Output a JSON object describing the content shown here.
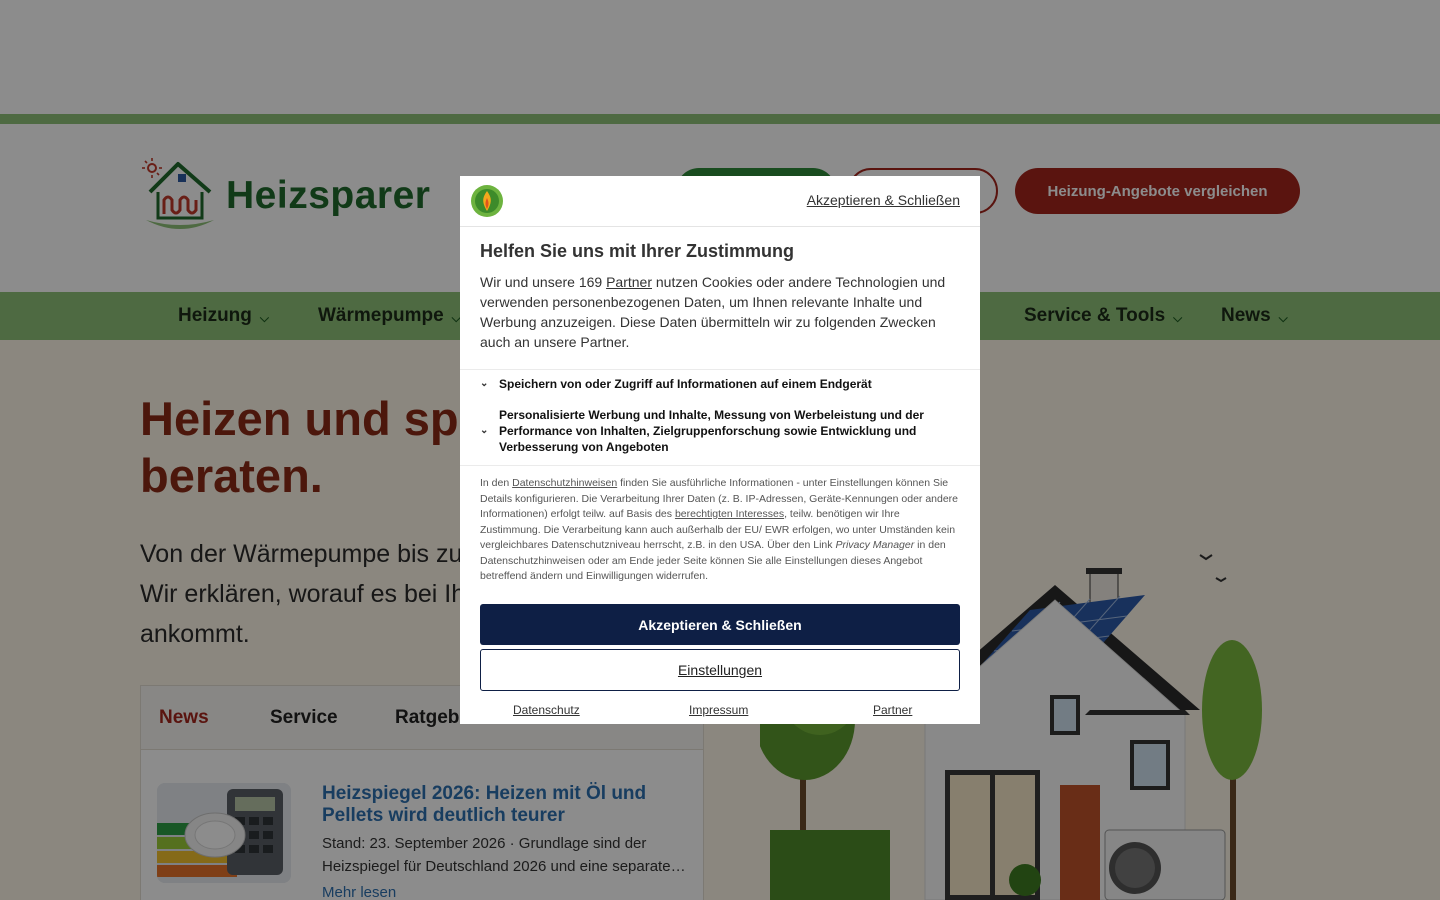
{
  "header": {
    "logo_text": "Heizsparer",
    "btn_partner_label": "",
    "btn_outline_label": "",
    "cta_label": "Heizung-Angebote vergleichen"
  },
  "nav": {
    "items": [
      {
        "label": "Heizung"
      },
      {
        "label": "Wärmepumpe"
      },
      {
        "label": "Service & Tools"
      },
      {
        "label": "News"
      }
    ]
  },
  "hero": {
    "title_line1": "Heizen und spar",
    "title_line2": "beraten.",
    "text_line1": "Von der Wärmepumpe bis zu",
    "text_line2": "Wir erklären, worauf es bei Ih",
    "text_line3": "ankommt."
  },
  "news": {
    "tabs": [
      {
        "label": "News",
        "active": true
      },
      {
        "label": "Service"
      },
      {
        "label": "Ratgebe"
      }
    ],
    "article": {
      "title": "Heizspiegel 2026: Heizen mit Öl und Pellets wird deutlich teurer",
      "text": "Stand: 23. September 2026 · Grundlage sind der Heizspiegel für Deutschland 2026 und eine separate…",
      "more": "Mehr lesen"
    }
  },
  "consent": {
    "header_accept_link": "Akzeptieren & Schließen",
    "title": "Helfen Sie uns mit Ihrer Zustimmung",
    "intro_before": "Wir und unsere 169 ",
    "intro_partner_link": "Partner",
    "intro_after": " nutzen Cookies oder andere Technologien und verwenden personenbezogenen Daten, um Ihnen relevante Inhalte und Werbung anzuzeigen. Diese Daten übermitteln wir zu folgenden Zwecken auch an unsere Partner.",
    "purposes": [
      {
        "label": "Speichern von oder Zugriff auf Informationen auf einem Endgerät"
      },
      {
        "label": "Personalisierte Werbung und Inhalte, Messung von Werbeleistung und der Performance von Inhalten, Zielgruppenforschung sowie Entwicklung und Verbesserung von Angeboten"
      }
    ],
    "legal": {
      "p1": "In den ",
      "link_privacy": "Datenschutzhinweisen",
      "p2": " finden Sie ausführliche Informationen - unter Einstellungen können Sie Details konfigurieren. Die Verarbeitung Ihrer Daten (z. B. IP-Adressen, Geräte-Kennungen oder andere Informationen) erfolgt teilw. auf Basis des ",
      "link_interest": "berechtigten Interesses",
      "p3": ", teilw. benötigen wir Ihre Zustimmung. Die Verarbeitung kann auch außerhalb der EU/ EWR erfolgen, wo unter Umständen kein vergleichbares Datenschutzniveau herrscht, z.B. in den USA. Über den Link ",
      "privacy_manager": "Privacy Manager",
      "p4": " in den Datenschutzhinweisen oder am Ende jeder Seite können Sie alle Einstellungen dieses Angebot betreffend ändern und Einwilligungen widerrufen."
    },
    "accept_button": "Akzeptieren & Schließen",
    "settings_button": "Einstellungen",
    "footer": {
      "privacy": "Datenschutz",
      "imprint": "Impressum",
      "partner": "Partner"
    }
  },
  "colors": {
    "brand_green": "#1f6b2c",
    "nav_green": "#8ec279",
    "brand_red": "#a4251d",
    "consent_navy": "#0e1f45"
  }
}
